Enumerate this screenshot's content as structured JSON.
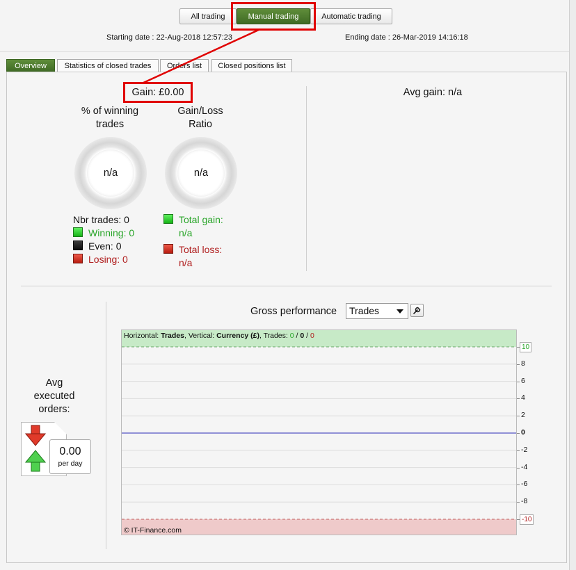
{
  "header": {
    "mode_buttons": [
      {
        "label": "All trading",
        "active": false
      },
      {
        "label": "Manual trading",
        "active": true
      },
      {
        "label": "Automatic trading",
        "active": false
      }
    ],
    "starting_date_label": "Starting date :",
    "starting_date_value": "22-Aug-2018 12:57:23",
    "ending_date_label": "Ending date :",
    "ending_date_value": "26-Mar-2019 14:16:18"
  },
  "tabs": [
    {
      "label": "Overview",
      "active": true
    },
    {
      "label": "Statistics of closed trades",
      "active": false
    },
    {
      "label": "Orders list",
      "active": false
    },
    {
      "label": "Closed positions list",
      "active": false
    }
  ],
  "overview": {
    "gain": "Gain: £0.00",
    "avg_gain": "Avg gain: n/a",
    "winning_pct_label_1": "% of winning",
    "winning_pct_label_2": "trades",
    "winning_pct_value": "n/a",
    "ratio_label_1": "Gain/Loss",
    "ratio_label_2": "Ratio",
    "ratio_value": "n/a",
    "nbr_trades": "Nbr trades: 0",
    "winning": "Winning: 0",
    "even": "Even: 0",
    "losing": "Losing: 0",
    "total_gain_label": "Total gain:",
    "total_gain_value": "n/a",
    "total_loss_label": "Total loss:",
    "total_loss_value": "n/a"
  },
  "orders": {
    "label_1": "Avg",
    "label_2": "executed",
    "label_3": "orders:",
    "value": "0.00",
    "unit": "per day"
  },
  "chart_controls": {
    "title": "Gross performance",
    "selected": "Trades"
  },
  "chart_data": {
    "type": "line",
    "info_prefix_h": "Horizontal:",
    "info_h_value": "Trades",
    "info_prefix_v": ", Vertical:",
    "info_v_value": "Currency (£)",
    "info_prefix_t": ", Trades:",
    "trades_win": "0",
    "trades_sep1": " / ",
    "trades_even": "0",
    "trades_sep2": " / ",
    "trades_loss": "0",
    "ylim": [
      -10,
      10
    ],
    "yticks": [
      10,
      8,
      6,
      4,
      2,
      0,
      -2,
      -4,
      -6,
      -8,
      -10
    ],
    "ytick_labels": [
      "10",
      "8",
      "6",
      "4",
      "2",
      "0",
      "-2",
      "-4",
      "-6",
      "-8",
      "-10"
    ],
    "series": [
      {
        "x": [],
        "y": []
      }
    ],
    "zero_line": 0,
    "grid": true,
    "copyright": "© IT-Finance.com",
    "colors": {
      "positive_zone": "#c7eac7",
      "negative_zone": "#efcaca",
      "zero_line": "#2b2bb8"
    }
  }
}
